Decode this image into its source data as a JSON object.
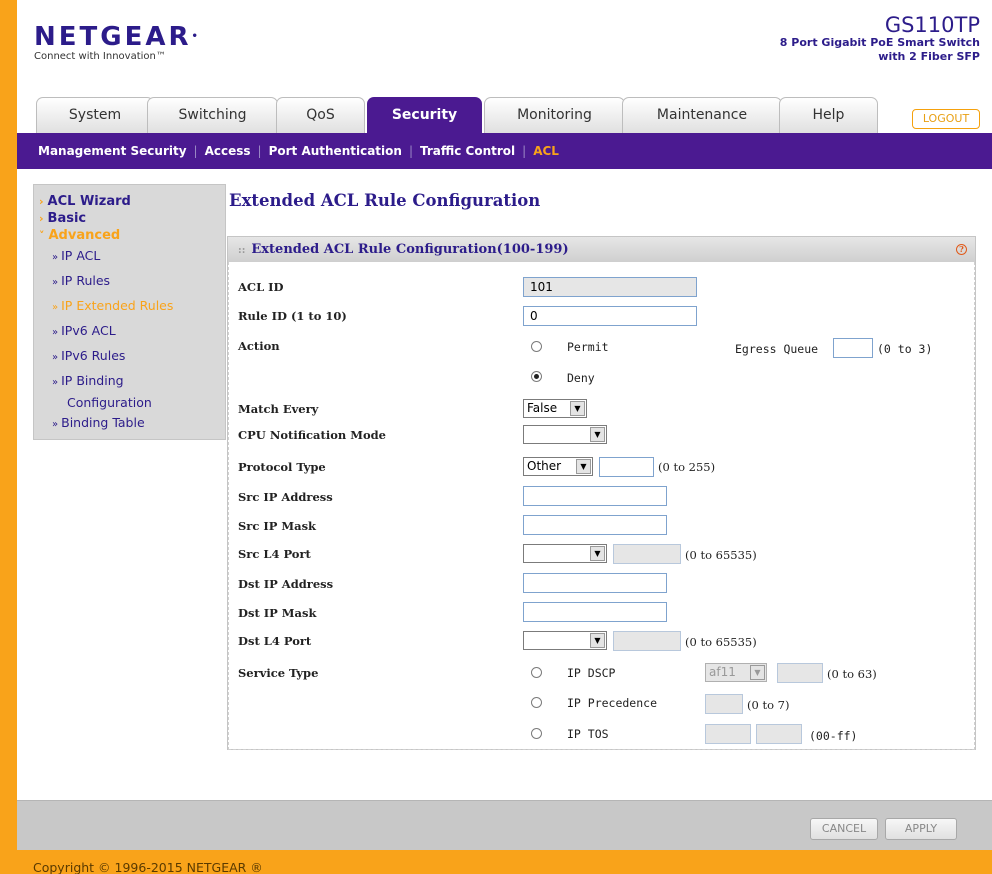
{
  "brand": {
    "logo": "NETGEAR",
    "tagline": "Connect with Innovation™"
  },
  "model": {
    "name": "GS110TP",
    "desc_line1": "8 Port Gigabit PoE Smart Switch",
    "desc_line2": "with 2 Fiber SFP"
  },
  "tabs": [
    "System",
    "Switching",
    "QoS",
    "Security",
    "Monitoring",
    "Maintenance",
    "Help"
  ],
  "logout_label": "LOGOUT",
  "subnav": [
    "Management Security",
    "Access",
    "Port Authentication",
    "Traffic Control",
    "ACL"
  ],
  "sidebar": {
    "acl_wizard": "ACL Wizard",
    "basic": "Basic",
    "advanced": "Advanced",
    "items": [
      "IP ACL",
      "IP Rules",
      "IP Extended Rules",
      "IPv6 ACL",
      "IPv6 Rules",
      "IP Binding",
      "Configuration",
      "Binding Table"
    ]
  },
  "page_title": "Extended ACL Rule Configuration",
  "panel_title": "Extended ACL Rule Configuration(100-199)",
  "form": {
    "acl_id_label": "ACL ID",
    "acl_id_value": "101",
    "rule_id_label": "Rule ID (1 to 10)",
    "rule_id_value": "0",
    "action_label": "Action",
    "permit_label": "Permit",
    "deny_label": "Deny",
    "egress_label": "Egress Queue",
    "egress_value": "",
    "egress_hint": "(0 to 3)",
    "match_every_label": "Match Every",
    "match_every_value": "False",
    "cpu_label": "CPU Notification Mode",
    "cpu_value": "",
    "protocol_label": "Protocol Type",
    "protocol_value": "Other",
    "protocol_num": "",
    "protocol_hint": "(0 to 255)",
    "src_ip_label": "Src IP Address",
    "src_ip_value": "",
    "src_mask_label": "Src IP Mask",
    "src_mask_value": "",
    "src_l4_label": "Src L4 Port",
    "src_l4_value": "",
    "src_l4_num": "",
    "src_l4_hint": "(0 to 65535)",
    "dst_ip_label": "Dst IP Address",
    "dst_ip_value": "",
    "dst_mask_label": "Dst IP Mask",
    "dst_mask_value": "",
    "dst_l4_label": "Dst L4 Port",
    "dst_l4_value": "",
    "dst_l4_num": "",
    "dst_l4_hint": "(0 to 65535)",
    "service_label": "Service Type",
    "dscp_label": "IP DSCP",
    "dscp_value": "af11",
    "dscp_hint": "(0 to 63)",
    "prec_label": "IP Precedence",
    "prec_hint": "(0 to 7)",
    "tos_label": "IP TOS",
    "tos_hint": "(00-ff)"
  },
  "buttons": {
    "cancel": "CANCEL",
    "apply": "APPLY"
  },
  "copyright": "Copyright © 1996-2015 NETGEAR ®"
}
